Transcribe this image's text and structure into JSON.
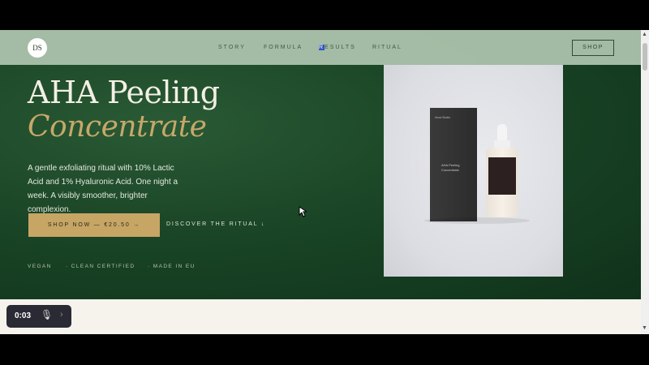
{
  "nav": {
    "logo": "DS",
    "links": [
      "STORY",
      "FORMULA",
      "RESULTS",
      "RITUAL"
    ],
    "results_first": "R",
    "results_rest": "ESULTS",
    "shop": "SHOP"
  },
  "hero": {
    "title_line1": "AHA Peeling",
    "title_line2": "Concentrate",
    "description": "A gentle exfoliating ritual with 10% Lactic Acid and 1% Hyaluronic Acid. One night a week. A visibly smoother, brighter complexion.",
    "cta": "SHOP NOW — €20.50 →",
    "discover": "DISCOVER THE RITUAL ↓",
    "badges": [
      "VEGAN",
      "· CLEAN CERTIFIED",
      "· MADE IN EU"
    ]
  },
  "product": {
    "box_brand": "Nova Studio",
    "box_name": "AHA Peeling Concentrate"
  },
  "video": {
    "time": "0:03",
    "mic_icon": "mic-muted-icon",
    "next_icon": "chevron-right-icon"
  }
}
